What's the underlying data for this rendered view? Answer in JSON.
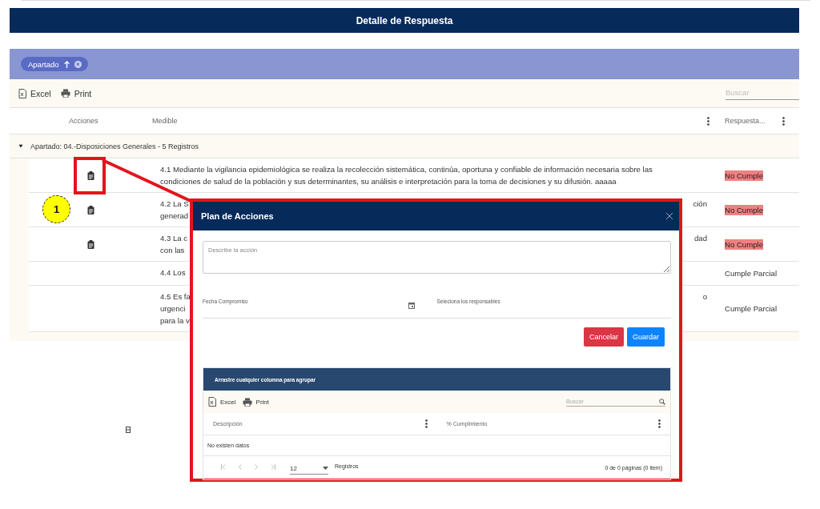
{
  "page_title": "Detalle de Respuesta",
  "group_panel": {
    "chips": [
      {
        "label": "Apartado",
        "sort_ascending": true
      }
    ]
  },
  "toolbar": {
    "buttons": [
      {
        "label": "Excel",
        "kind": "excel"
      },
      {
        "label": "Print",
        "kind": "print"
      }
    ],
    "search": {
      "placeholder": "Buscar"
    }
  },
  "table": {
    "columns": [
      {
        "label": "Acciones",
        "menu": false
      },
      {
        "label": "Medible",
        "menu": true
      },
      {
        "label": "Respuesta...",
        "menu": true
      }
    ],
    "group": {
      "label": "Apartado: 04.-Disposiciones Generales - 5 Registros",
      "expanded": true
    },
    "rows": [
      {
        "has_action": true,
        "medible_left": [
          "4.1 Mediante la vigilancia epidemiológica se realiza la recolección sistemática, continúa, oportuna y confiable de información necesaria sobre las",
          "condiciones de salud de la población y sus determinantes, su análisis e interpretación para la toma de decisiones y su difusión. aaaaa"
        ],
        "medible_right": [],
        "respuesta": "No Cumple",
        "highlighted": true
      },
      {
        "has_action": true,
        "medible_left": [
          "4.2 La S",
          "generad"
        ],
        "medible_right": [
          "ción"
        ],
        "respuesta": "No Cumple",
        "highlighted": true
      },
      {
        "has_action": true,
        "medible_left": [
          "4.3 La c",
          "con las"
        ],
        "medible_right": [
          "dad"
        ],
        "respuesta": "No Cumple",
        "highlighted": true
      },
      {
        "has_action": false,
        "medible_left": [
          "4.4 Los"
        ],
        "medible_right": [],
        "respuesta": "Cumple Parcial",
        "highlighted": false
      },
      {
        "has_action": false,
        "medible_left": [
          "4.5 Es fa",
          "urgenci",
          "para la v"
        ],
        "medible_right": [
          "o"
        ],
        "respuesta": "Cumple Parcial",
        "highlighted": false
      }
    ]
  },
  "annotation": {
    "step": "1"
  },
  "dialog": {
    "title": "Plan de Acciones",
    "action_field": {
      "placeholder": "Describe la acción"
    },
    "date_field": {
      "label": "Fecha Compromiso"
    },
    "responsables_field": {
      "label": "Seleciona los responsables"
    },
    "buttons": [
      {
        "label": "Cancelar",
        "kind": "danger"
      },
      {
        "label": "Guardar",
        "kind": "primary"
      }
    ],
    "grid": {
      "group_hint": "Arrastre cualquier columna para agrupar",
      "toolbar": {
        "buttons": [
          {
            "label": "Excel",
            "kind": "excel"
          },
          {
            "label": "Print",
            "kind": "print"
          }
        ],
        "search": {
          "placeholder": "Buscar"
        }
      },
      "columns": [
        {
          "label": "Descripción"
        },
        {
          "label": "% Cumplimiento"
        }
      ],
      "empty": "No existen datos",
      "pager": {
        "page_size": "12",
        "size_label": "Registros",
        "info": "0 de 0 páginas (0 item)"
      }
    }
  }
}
